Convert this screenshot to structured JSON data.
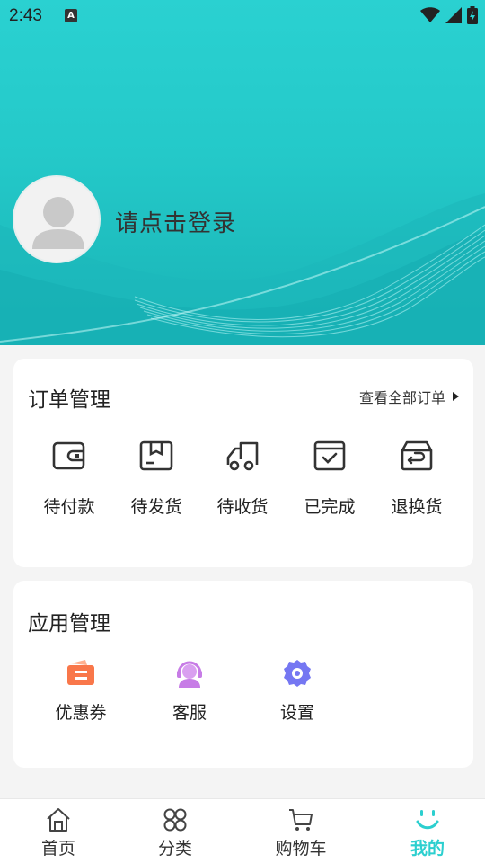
{
  "status_bar": {
    "time": "2:43",
    "notification_glyph": "A"
  },
  "profile": {
    "login_prompt": "请点击登录",
    "avatar_icon": "default-avatar-icon"
  },
  "orders": {
    "title": "订单管理",
    "view_all": "查看全部订单",
    "items": [
      {
        "label": "待付款",
        "icon": "wallet-icon"
      },
      {
        "label": "待发货",
        "icon": "package-icon"
      },
      {
        "label": "待收货",
        "icon": "truck-icon"
      },
      {
        "label": "已完成",
        "icon": "completed-box-icon"
      },
      {
        "label": "退换货",
        "icon": "return-box-icon"
      }
    ]
  },
  "apps": {
    "title": "应用管理",
    "items": [
      {
        "label": "优惠券",
        "icon": "coupon-icon",
        "color": "#f9774a"
      },
      {
        "label": "客服",
        "icon": "customer-service-icon",
        "color": "#c77ce6"
      },
      {
        "label": "设置",
        "icon": "settings-gear-icon",
        "color": "#7577f2"
      }
    ]
  },
  "nav": {
    "items": [
      {
        "label": "首页",
        "icon": "home-icon"
      },
      {
        "label": "分类",
        "icon": "category-icon"
      },
      {
        "label": "购物车",
        "icon": "cart-icon"
      },
      {
        "label": "我的",
        "icon": "smile-icon",
        "active": true
      }
    ]
  },
  "colors": {
    "accent": "#2ccfcf",
    "header": "#24c9c9"
  }
}
